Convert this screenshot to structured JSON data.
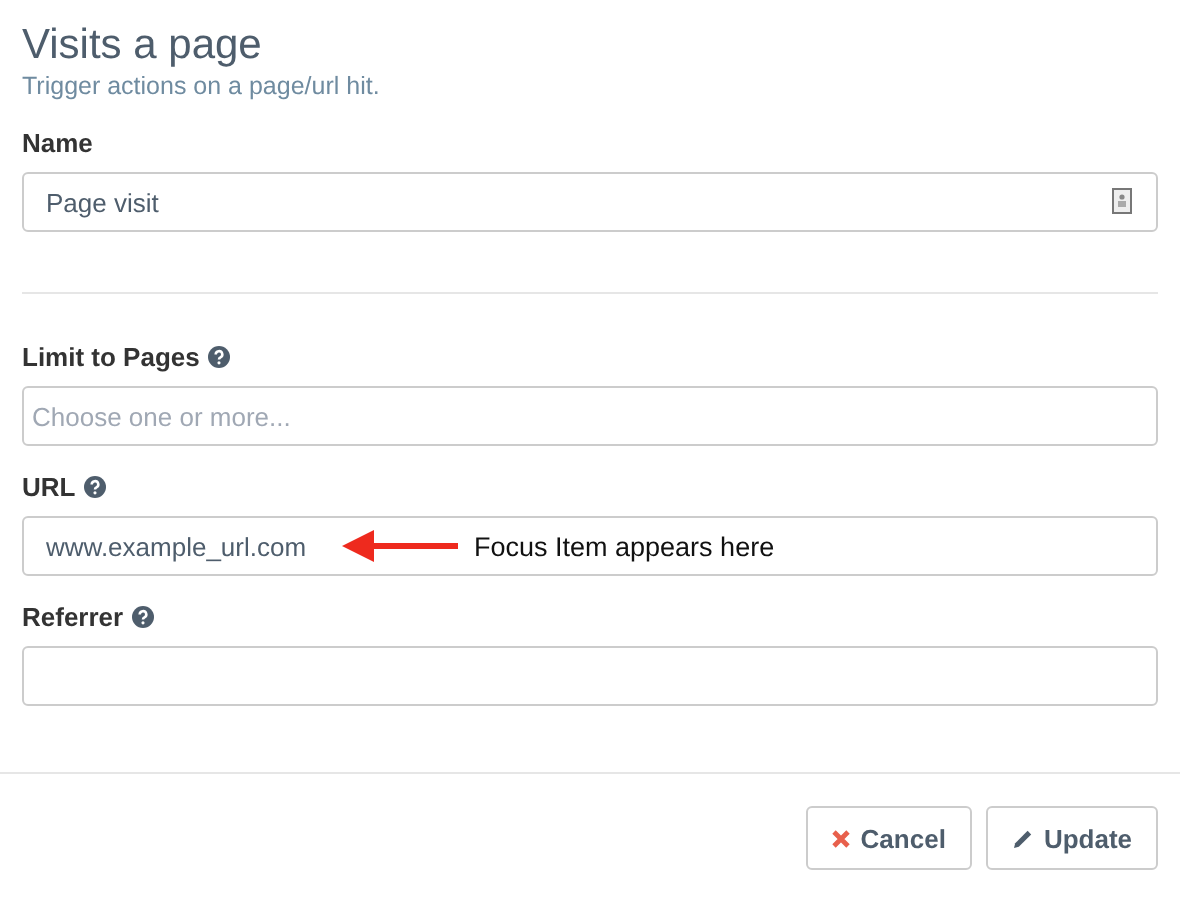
{
  "header": {
    "title": "Visits a page",
    "subtitle": "Trigger actions on a page/url hit."
  },
  "fields": [
    {
      "kind": "contact",
      "label": "Name",
      "help": false,
      "value": "Page visit",
      "divider_after": true
    },
    {
      "kind": "select",
      "label": "Limit to Pages",
      "help": true,
      "placeholder": "Choose one or more..."
    },
    {
      "kind": "text",
      "label": "URL",
      "help": true,
      "value": "www.example_url.com",
      "annotation": "Focus Item appears here"
    },
    {
      "kind": "text",
      "label": "Referrer",
      "help": true
    }
  ],
  "buttons": [
    {
      "kind": "cancel",
      "label": "Cancel"
    },
    {
      "kind": "update",
      "label": "Update"
    }
  ]
}
